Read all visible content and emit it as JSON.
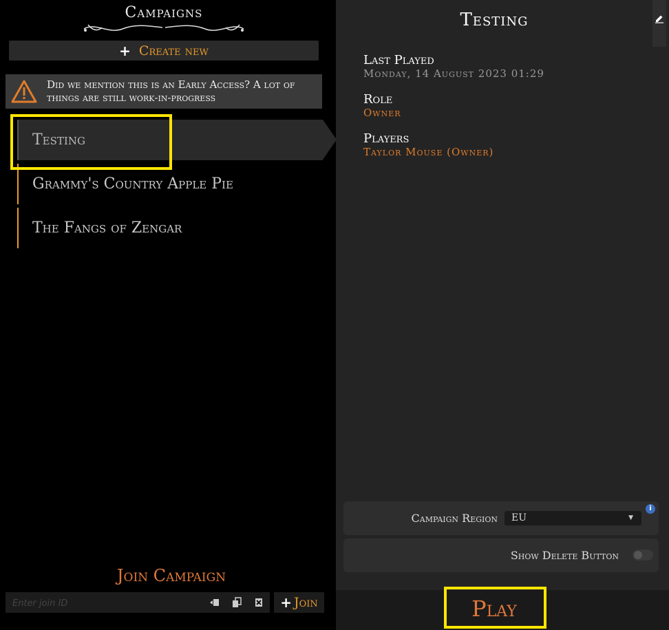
{
  "left": {
    "title": "Campaigns",
    "create_label": "Create new",
    "warning": "Did we mention this is an Early Access? A lot of things are still work-in-progress",
    "campaigns": [
      {
        "name": "Testing"
      },
      {
        "name": "Grammy's Country Apple Pie"
      },
      {
        "name": "The Fangs of Zengar"
      }
    ],
    "join": {
      "title": "Join Campaign",
      "placeholder": "Enter join ID",
      "button_label": "Join",
      "icons": [
        "paste-icon",
        "copy-icon",
        "clear-icon"
      ]
    }
  },
  "right": {
    "title": "Testing",
    "last_played_label": "Last Played",
    "last_played_value": "Monday, 14 August 2023 01:29",
    "role_label": "Role",
    "role_value": "Owner",
    "players_label": "Players",
    "players_value": "Taylor Mouse (Owner)",
    "region_label": "Campaign Region",
    "region_value": "EU",
    "info_badge": "i",
    "show_delete_label": "Show Delete Button",
    "show_delete_on": false,
    "play_label": "Play"
  },
  "colors": {
    "accent": "#e79a2c",
    "highlight": "#ffe600",
    "panel": "#242424"
  }
}
